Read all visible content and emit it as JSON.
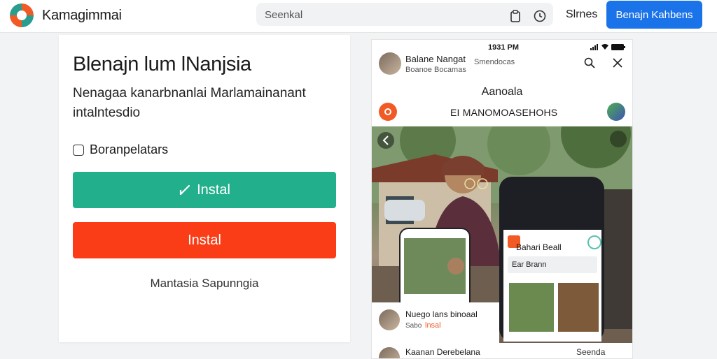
{
  "header": {
    "brand": "Kamagimmai",
    "search_placeholder": "Seenkal",
    "signin_label": "Slrnes",
    "cta_label": "Benajn Kahbens"
  },
  "card": {
    "title": "Blenajn lum lNanjsia",
    "description": "Nenagaa kanarbnanlai Marlamainanant intalntesdio",
    "checkbox_label": "Boranpelatars",
    "install_primary": "Instal",
    "install_secondary": "Instal",
    "more_link": "Mantasia Sapunngia"
  },
  "phone": {
    "time": "1931 PM",
    "profile_name": "Balane Nangat",
    "profile_sub": "Boanoe Bocamas",
    "profile_mid": "Smendocas",
    "heading": "Aanoala",
    "row_text": "EI MANOMOASEHOHS",
    "inner_card_title": "Bahari Beall",
    "inner_card_chip": "Ear Brann",
    "post_name": "Nuego lans binoaal",
    "post_sub": "Sabo",
    "post_badge": "lnsal",
    "bottom_name": "Kaanan Derebelana",
    "bottom_right": "Seenda"
  },
  "colors": {
    "accent_blue": "#1a73e8",
    "install_green": "#22b08c",
    "install_red": "#fa3d16",
    "brand_orange": "#f15a24"
  }
}
